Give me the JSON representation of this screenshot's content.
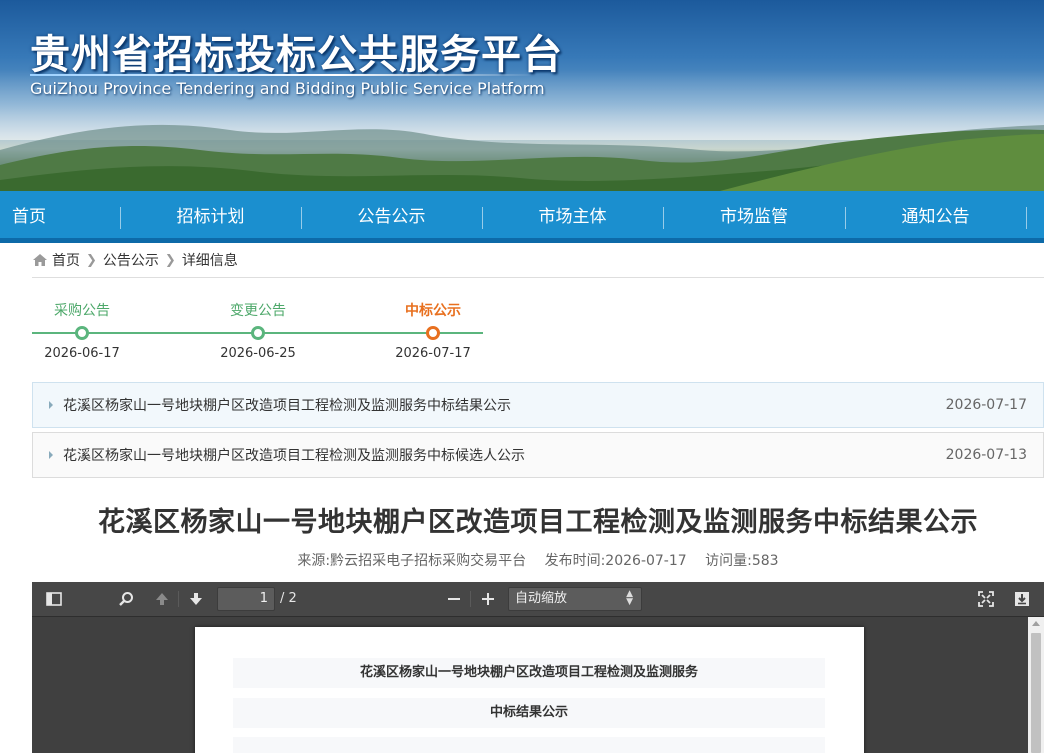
{
  "banner": {
    "title": "贵州省招标投标公共服务平台",
    "subtitle": "GuiZhou Province Tendering and Bidding Public Service Platform"
  },
  "nav": {
    "items": [
      {
        "label": "首页"
      },
      {
        "label": "招标计划"
      },
      {
        "label": "公告公示"
      },
      {
        "label": "市场主体"
      },
      {
        "label": "市场监管"
      },
      {
        "label": "通知公告"
      }
    ]
  },
  "breadcrumb": {
    "home": "首页",
    "level1": "公告公示",
    "level2": "详细信息"
  },
  "timeline": {
    "steps": [
      {
        "label": "采购公告",
        "date": "2026-06-17",
        "current": false
      },
      {
        "label": "变更公告",
        "date": "2026-06-25",
        "current": false
      },
      {
        "label": "中标公示",
        "date": "2026-07-17",
        "current": true
      }
    ]
  },
  "related": [
    {
      "title": "花溪区杨家山一号地块棚户区改造项目工程检测及监测服务中标结果公示",
      "date": "2026-07-17",
      "active": true
    },
    {
      "title": "花溪区杨家山一号地块棚户区改造项目工程检测及监测服务中标候选人公示",
      "date": "2026-07-13",
      "active": false
    }
  ],
  "article": {
    "title": "花溪区杨家山一号地块棚户区改造项目工程检测及监测服务中标结果公示",
    "source": "来源:黔云招采电子招标采购交易平台",
    "publish_time": "发布时间:2026-07-17",
    "visits": "访问量:583"
  },
  "pdf_viewer": {
    "page_current": "1",
    "page_total": "/ 2",
    "zoom": "自动缩放",
    "doc_line1": "花溪区杨家山一号地块棚户区改造项目工程检测及监测服务",
    "doc_line2": "中标结果公示"
  },
  "colors": {
    "nav_bg": "#1b8fcf",
    "timeline_done": "#5bb57d",
    "timeline_current": "#e8701f"
  }
}
